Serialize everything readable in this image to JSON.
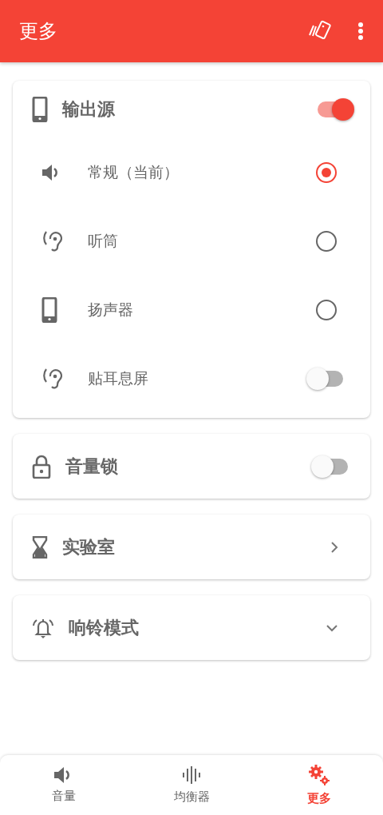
{
  "app_bar": {
    "title": "更多"
  },
  "output_card": {
    "title": "输出源",
    "on": true,
    "options": [
      {
        "label": "常规（当前）",
        "kind": "radio",
        "selected": true
      },
      {
        "label": "听筒",
        "kind": "radio",
        "selected": false
      },
      {
        "label": "扬声器",
        "kind": "radio",
        "selected": false
      },
      {
        "label": "贴耳息屏",
        "kind": "switch",
        "on": false
      }
    ]
  },
  "cards": [
    {
      "title": "音量锁",
      "kind": "switch",
      "on": false
    },
    {
      "title": "实验室",
      "kind": "link"
    },
    {
      "title": "响铃模式",
      "kind": "expand",
      "expanded": false
    }
  ],
  "bottom_nav": [
    {
      "label": "音量",
      "selected": false
    },
    {
      "label": "均衡器",
      "selected": false
    },
    {
      "label": "更多",
      "selected": true
    }
  ]
}
